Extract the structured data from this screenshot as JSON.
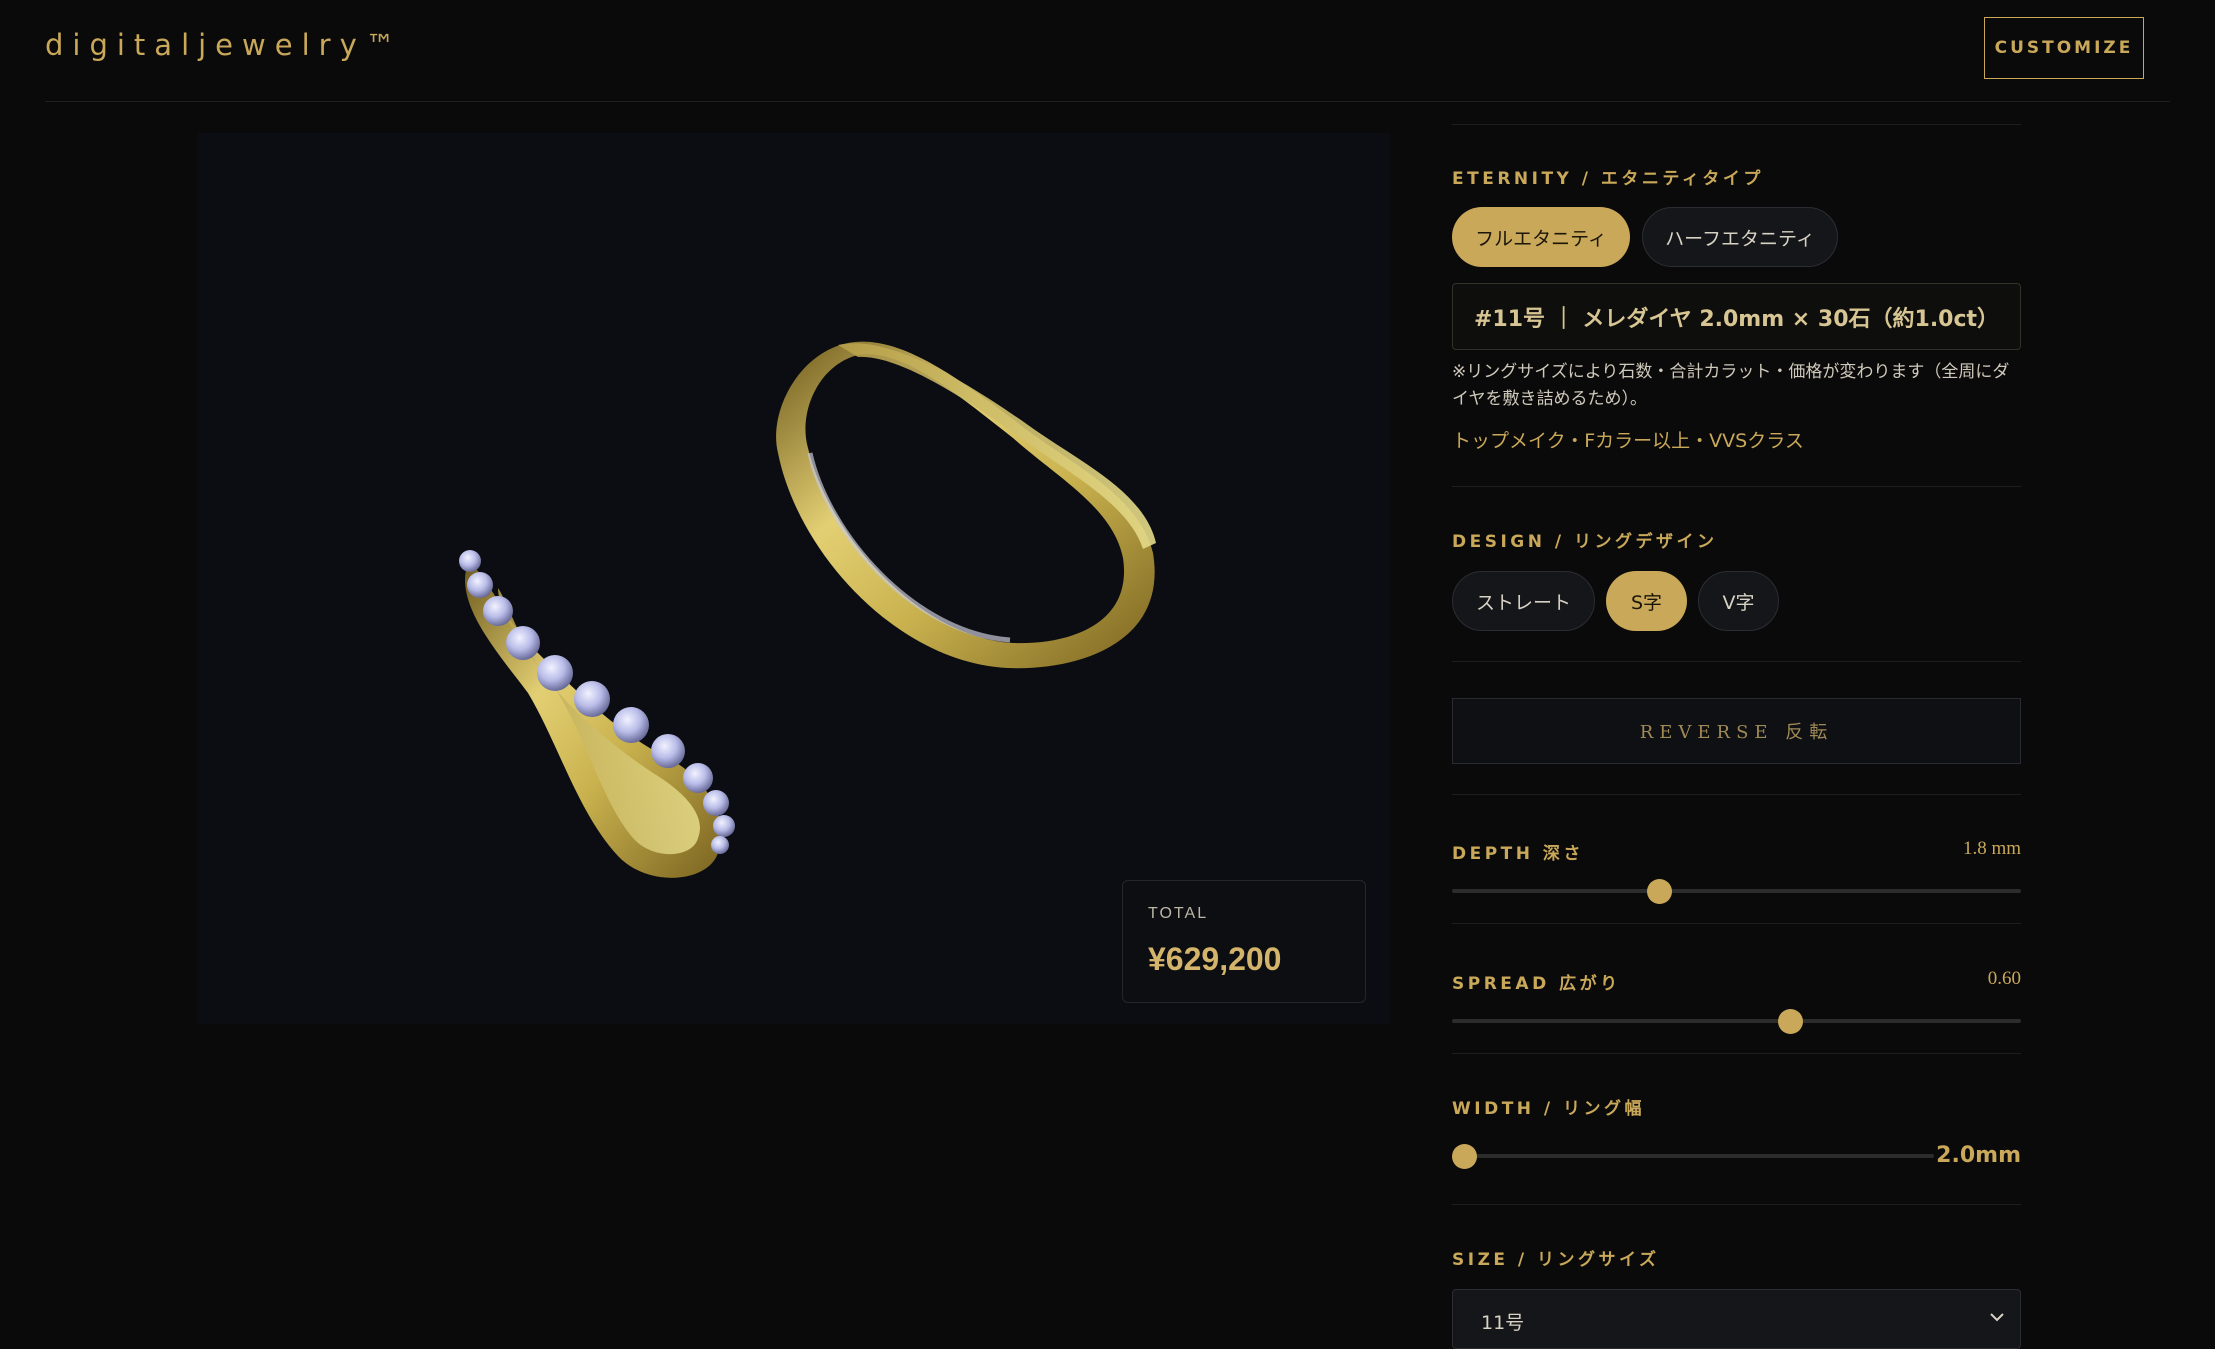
{
  "header": {
    "brand": "digitaljewelry™",
    "customize_label": "CUSTOMIZE"
  },
  "viewer": {
    "total_label": "TOTAL",
    "total_value": "¥629,200"
  },
  "eternity": {
    "label": "ETERNITY / エタニティタイプ",
    "options": [
      "フルエタニティ",
      "ハーフエタニティ"
    ],
    "selected": "フルエタニティ",
    "spec": "#11号 ｜ メレダイヤ 2.0mm × 30石（約1.0ct）",
    "note": "※リングサイズにより石数・合計カラット・価格が変わります（全周にダイヤを敷き詰めるため）。",
    "quality": "トップメイク・Fカラー以上・VVSクラス"
  },
  "design": {
    "label": "DESIGN / リングデザイン",
    "options": [
      "ストレート",
      "S字",
      "V字"
    ],
    "selected": "S字"
  },
  "reverse": {
    "label": "REVERSE 反転"
  },
  "depth": {
    "label": "DEPTH 深さ",
    "value_text": "1.8 mm",
    "fraction": 0.365
  },
  "spread": {
    "label": "SPREAD 広がり",
    "value_text": "0.60",
    "fraction": 0.595
  },
  "width": {
    "label": "WIDTH / リング幅",
    "value_text": "2.0mm",
    "fraction": 0.0
  },
  "size": {
    "label": "SIZE / リングサイズ",
    "selected": "11号"
  },
  "colors": {
    "accent": "#c9a85a",
    "background": "#0a0a0a",
    "viewer_bg": "#0b0d12"
  }
}
